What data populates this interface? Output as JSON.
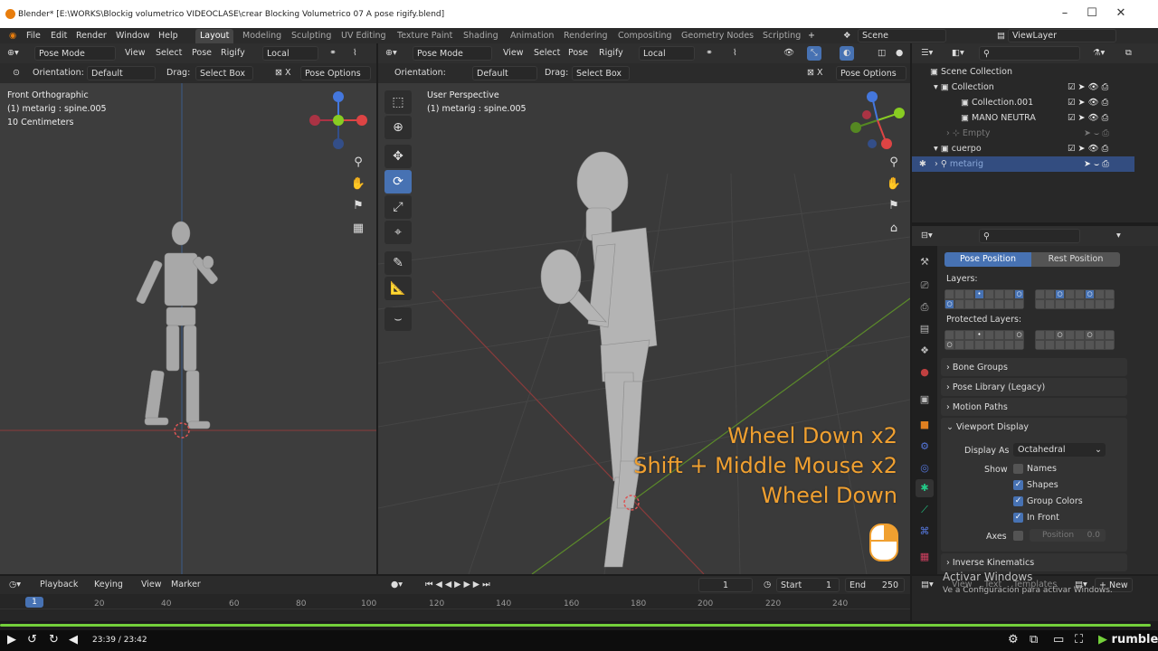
{
  "window": {
    "title": "Blender* [E:\\WORKS\\Blockig volumetrico VIDEOCLASE\\crear Blocking Volumetrico 07 A pose rigify.blend]",
    "min": "–",
    "max": "☐",
    "close": "✕"
  },
  "menu": [
    "File",
    "Edit",
    "Render",
    "Window",
    "Help"
  ],
  "workspaces": [
    "Layout",
    "Modeling",
    "Sculpting",
    "UV Editing",
    "Texture Paint",
    "Shading",
    "Animation",
    "Rendering",
    "Compositing",
    "Geometry Nodes",
    "Scripting"
  ],
  "scene": "Scene",
  "view_layer": "ViewLayer",
  "left_view": {
    "mode": "Pose Mode",
    "menus": [
      "View",
      "Select",
      "Pose",
      "Rigify"
    ],
    "transform": "Local",
    "orientation_label": "Orientation:",
    "orientation": "Default",
    "drag_label": "Drag:",
    "drag": "Select Box",
    "pose_options": "Pose Options",
    "overlay": [
      "Front Orthographic",
      "(1) metarig : spine.005",
      "10 Centimeters"
    ]
  },
  "right_view": {
    "mode": "Pose Mode",
    "menus": [
      "View",
      "Select",
      "Pose",
      "Rigify"
    ],
    "transform": "Local",
    "orientation_label": "Orientation:",
    "orientation": "Default",
    "drag_label": "Drag:",
    "drag": "Select Box",
    "pose_options": "Pose Options",
    "overlay": [
      "User Perspective",
      "(1) metarig : spine.005"
    ]
  },
  "keys_overlay": [
    "Wheel Down x2",
    "Shift + Middle Mouse x2",
    "Wheel Down"
  ],
  "outliner": {
    "rows": [
      {
        "label": "Scene Collection",
        "indent": 0
      },
      {
        "label": "Collection",
        "indent": 1
      },
      {
        "label": "Collection.001",
        "indent": 2
      },
      {
        "label": "MANO NEUTRA",
        "indent": 2
      },
      {
        "label": "Empty",
        "indent": 2
      },
      {
        "label": "cuerpo",
        "indent": 1
      },
      {
        "label": "metarig",
        "indent": 2
      }
    ]
  },
  "properties": {
    "pose_position": "Pose Position",
    "rest_position": "Rest Position",
    "layers_label": "Layers:",
    "protected_label": "Protected Layers:",
    "panels": [
      "Bone Groups",
      "Pose Library (Legacy)",
      "Motion Paths"
    ],
    "viewport_display": "Viewport Display",
    "display_as_label": "Display As",
    "display_as": "Octahedral",
    "show_label": "Show",
    "names": "Names",
    "shapes": "Shapes",
    "group_colors": "Group Colors",
    "in_front": "In Front",
    "axes_label": "Axes",
    "position": "Position",
    "position_val": "0.0",
    "inverse_kinematics": "Inverse Kinematics"
  },
  "timeline": {
    "menus": [
      "Playback",
      "Keying",
      "View",
      "Marker"
    ],
    "current_frame": "1",
    "start_label": "Start",
    "start": "1",
    "end_label": "End",
    "end": "250",
    "ticks": [
      "1",
      "20",
      "40",
      "60",
      "80",
      "100",
      "120",
      "140",
      "160",
      "180",
      "200",
      "220",
      "240"
    ]
  },
  "bottom_right": {
    "menus": [
      "View",
      "Text",
      "Templates"
    ],
    "new": "New"
  },
  "activate": {
    "title": "Activar Windows",
    "sub": "Ve a Configuración para activar Windows."
  },
  "player": {
    "time": "23:39 / 23:42",
    "brand": "rumble"
  }
}
